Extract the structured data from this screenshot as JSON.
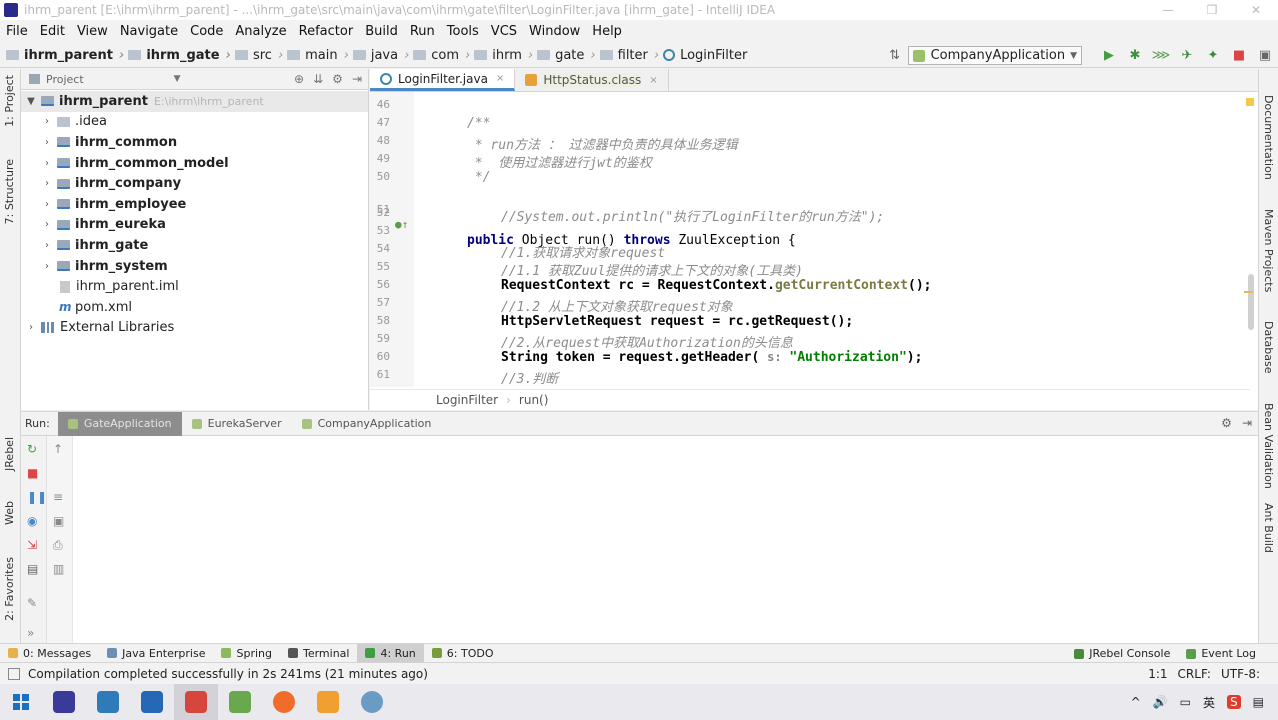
{
  "window": {
    "title": "ihrm_parent [E:\\ihrm\\ihrm_parent] - ...\\ihrm_gate\\src\\main\\java\\com\\ihrm\\gate\\filter\\LoginFilter.java [ihrm_gate] - IntelliJ IDEA",
    "minimize": "—",
    "restore": "❐",
    "close": "✕"
  },
  "menu": [
    "File",
    "Edit",
    "View",
    "Navigate",
    "Code",
    "Analyze",
    "Refactor",
    "Build",
    "Run",
    "Tools",
    "VCS",
    "Window",
    "Help"
  ],
  "breadcrumbs": [
    "ihrm_parent",
    "ihrm_gate",
    "src",
    "main",
    "java",
    "com",
    "ihrm",
    "gate",
    "filter",
    "LoginFilter"
  ],
  "run_config": "CompanyApplication",
  "left_strip": {
    "project": "1: Project",
    "structure": "7: Structure",
    "jrebel": "JRebel",
    "web": "Web",
    "favorites": "2: Favorites"
  },
  "right_strip": [
    "Documentation",
    "Maven Projects",
    "Database",
    "Bean Validation",
    "Ant Build"
  ],
  "project_panel": {
    "header": "Project",
    "tree": [
      {
        "label": "ihrm_parent",
        "extra": "E:\\ihrm\\ihrm_parent"
      },
      {
        "label": ".idea"
      },
      {
        "label": "ihrm_common"
      },
      {
        "label": "ihrm_common_model"
      },
      {
        "label": "ihrm_company"
      },
      {
        "label": "ihrm_employee"
      },
      {
        "label": "ihrm_eureka"
      },
      {
        "label": "ihrm_gate"
      },
      {
        "label": "ihrm_system"
      },
      {
        "label": "ihrm_parent.iml"
      },
      {
        "label": "pom.xml"
      },
      {
        "label": "External Libraries"
      }
    ]
  },
  "editor": {
    "tabs": [
      "LoginFilter.java",
      "HttpStatus.class"
    ],
    "lines": [
      {
        "n": "46"
      },
      {
        "n": "47",
        "c1": "/**"
      },
      {
        "n": "48",
        "c1": " * run方法 ： 过滤器中负责的具体业务逻辑"
      },
      {
        "n": "49",
        "c1": " *  使用过滤器进行jwt的鉴权"
      },
      {
        "n": "50",
        "c1": " */"
      },
      {
        "n": "51",
        "k1": "public",
        "t1": "Object",
        "f1": "run()",
        "k2": "throws",
        "t2": "ZuulException {"
      },
      {
        "n": "52",
        "c1": "//System.out.println(\"执行了LoginFilter的run方法\");"
      },
      {
        "n": "53"
      },
      {
        "n": "54",
        "c1": "//1.获取请求对象request"
      },
      {
        "n": "55",
        "c1": "//1.1 获取Zuul提供的请求上下文的对象(工具类)"
      },
      {
        "n": "56",
        "t1": "RequestContext rc = RequestContext.",
        "m1": "getCurrentContext",
        "t2": "();"
      },
      {
        "n": "57",
        "c1": "//1.2 从上下文对象获取request对象"
      },
      {
        "n": "58",
        "t1": "HttpServletRequest request = rc.getRequest();"
      },
      {
        "n": "59",
        "c1": "//2.从request中获取Authorization的头信息"
      },
      {
        "n": "60",
        "t1": "String token = request.getHeader(",
        "h1": "s:",
        "s1": "\"Authorization\"",
        "t2": ");"
      },
      {
        "n": "61",
        "c1": "//3.判断"
      }
    ],
    "crumbs": [
      "LoginFilter",
      "run()"
    ]
  },
  "run_panel": {
    "label": "Run:",
    "tabs": [
      "GateApplication",
      "EurekaServer",
      "CompanyApplication"
    ]
  },
  "toolwindows": {
    "left": [
      "0: Messages",
      "Java Enterprise",
      "Spring",
      "Terminal",
      "4: Run",
      "6: TODO"
    ],
    "right": [
      "JRebel Console",
      "Event Log"
    ]
  },
  "status": {
    "message": "Compilation completed successfully in 2s 241ms (21 minutes ago)",
    "position": "1:1",
    "line_sep": "CRLF:",
    "encoding": "UTF-8:"
  },
  "taskbar": {
    "tray": [
      "^",
      "🔊",
      "英"
    ],
    "apps": [
      "#3a3a9a",
      "#2f7ab8",
      "#2569b6",
      "#d6453e",
      "#6aa84f",
      "#ef6c2a",
      "#f0a030",
      "#6a9bc4"
    ]
  },
  "colors": {
    "accent": "#4a88c7",
    "keyword": "#000080",
    "comment": "#8c8c8c"
  }
}
